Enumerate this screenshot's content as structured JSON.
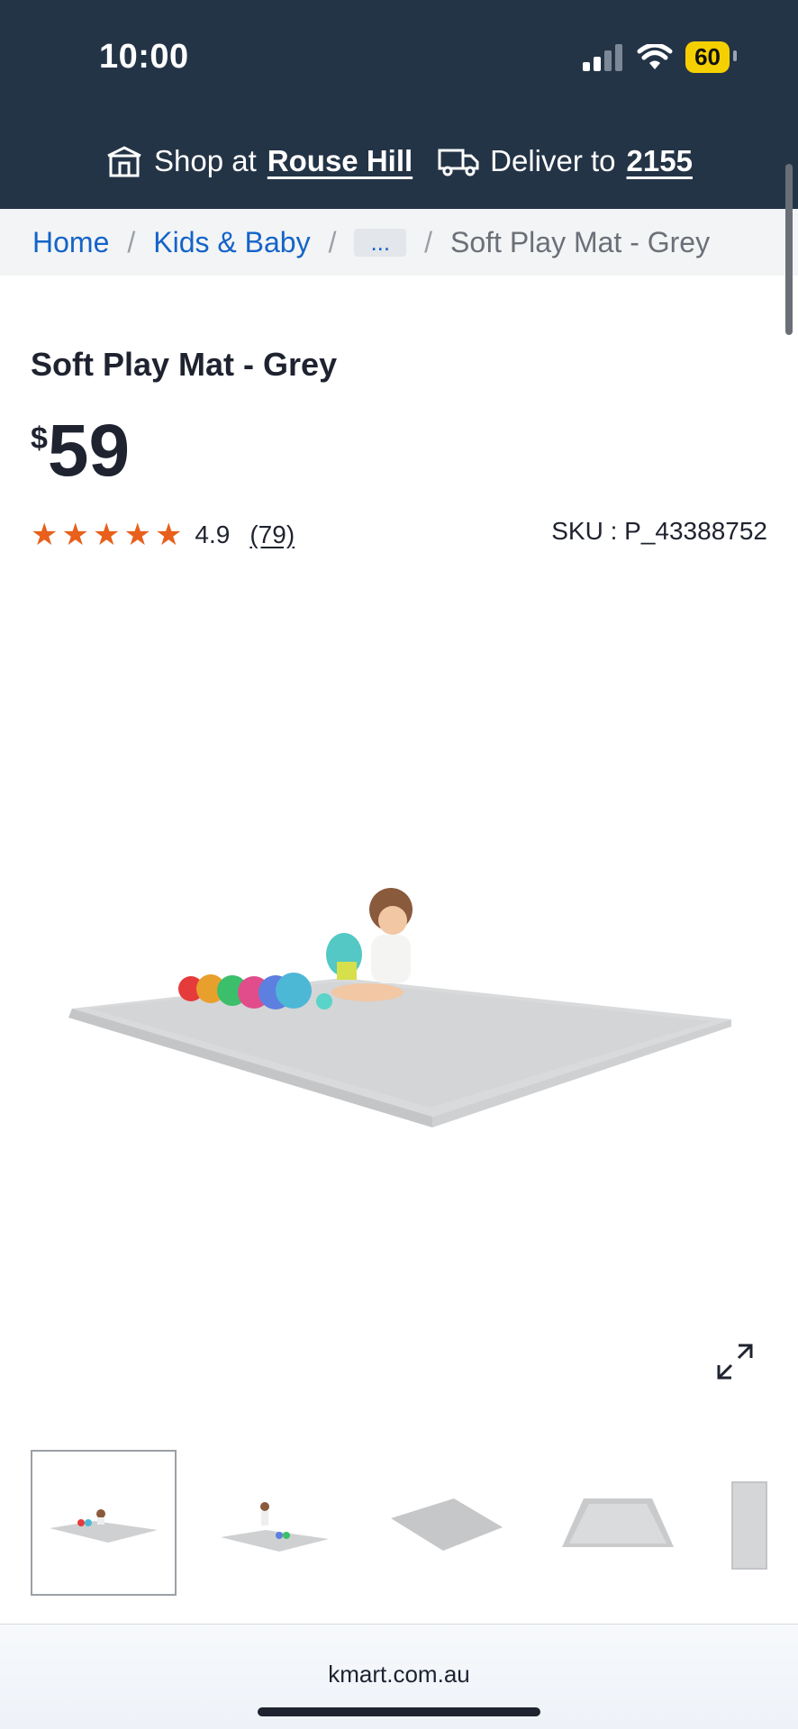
{
  "status": {
    "time": "10:00",
    "battery": "60"
  },
  "header": {
    "shop_prefix": "Shop at",
    "shop_store": "Rouse Hill",
    "deliver_prefix": "Deliver to",
    "deliver_postcode": "2155"
  },
  "breadcrumb": {
    "items": [
      "Home",
      "Kids & Baby",
      "...",
      "Soft Play Mat - Grey"
    ],
    "separator": "/"
  },
  "product": {
    "title": "Soft Play Mat - Grey",
    "currency": "$",
    "price": "59",
    "rating": "4.9",
    "rating_value": 4.9,
    "rating_max": 5,
    "review_count_text": "(79)",
    "sku": "SKU : P_43388752"
  },
  "gallery": {
    "thumbnail_count_visible": 5,
    "active_index": 0
  },
  "footer": {
    "domain": "kmart.com.au"
  },
  "colors": {
    "header_bg": "#243447",
    "link": "#1464c8",
    "star": "#e8601b",
    "battery": "#f5d000"
  },
  "icons": [
    "store-icon",
    "delivery-truck-icon",
    "star-icon",
    "expand-icon",
    "wifi-icon",
    "signal-icon"
  ]
}
